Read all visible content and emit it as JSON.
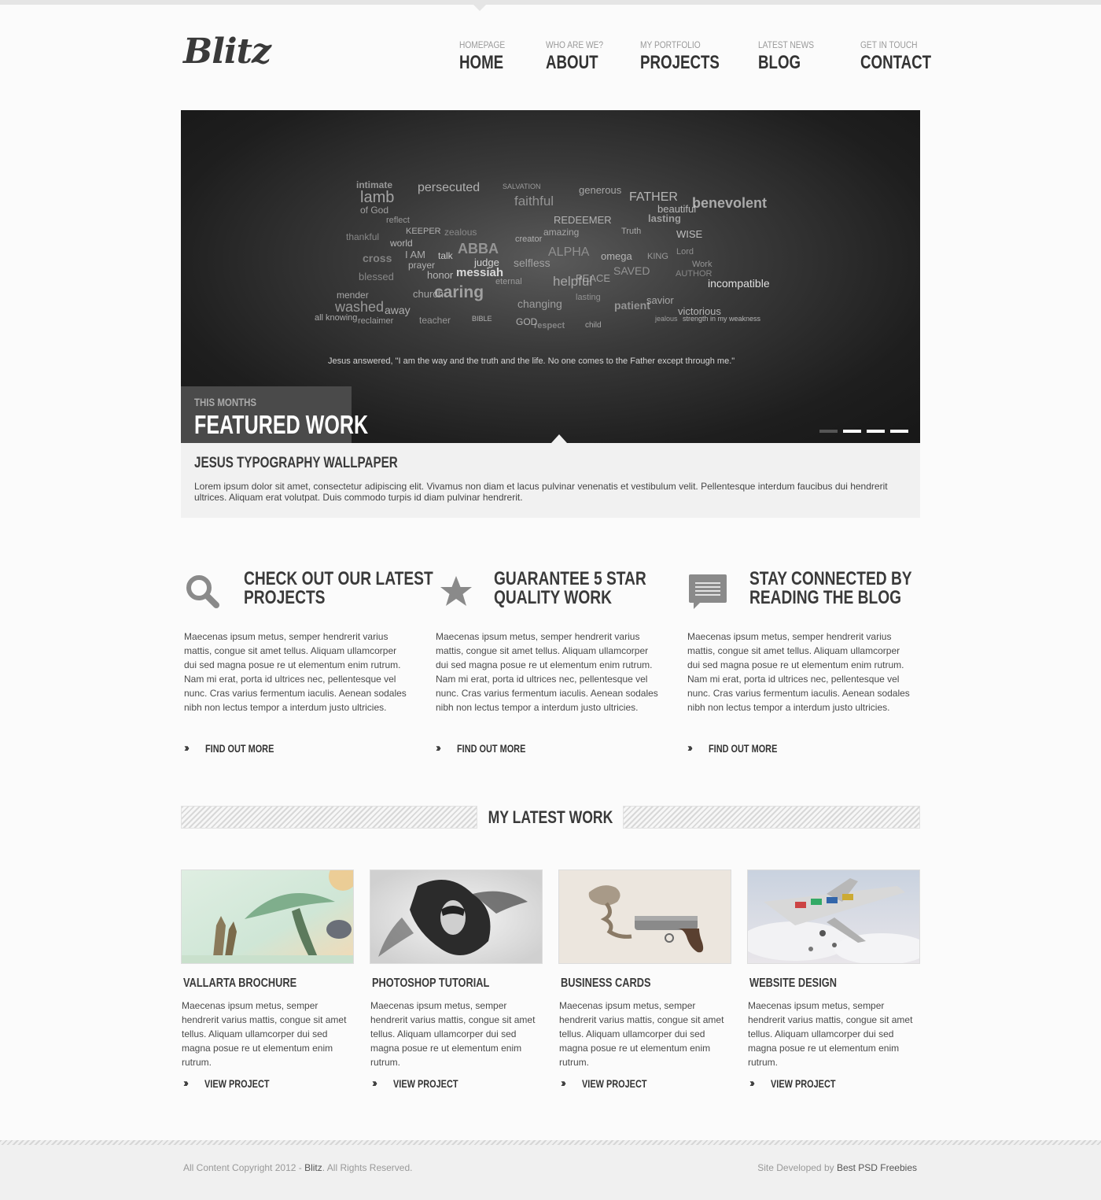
{
  "brand": {
    "logo": "Blitz"
  },
  "nav": [
    {
      "sub": "Homepage",
      "label": "Home"
    },
    {
      "sub": "Who are we?",
      "label": "About"
    },
    {
      "sub": "My Portfolio",
      "label": "Projects"
    },
    {
      "sub": "Latest News",
      "label": "Blog"
    },
    {
      "sub": "Get in touch",
      "label": "Contact"
    }
  ],
  "slider": {
    "quote": "Jesus answered, \"I am the way and the truth and the life. No one comes to the Father except through me.\"",
    "featured_small": "This months",
    "featured_big": "Featured Work",
    "dots_total": 4,
    "active_dot": 1,
    "cloud_words": [
      "intimate",
      "persecuted",
      "lamb",
      "SALVATION",
      "faithful",
      "generous",
      "FATHER",
      "benevolent",
      "of God",
      "reflect",
      "KEEPER",
      "zealous",
      "REDEEMER",
      "Truth",
      "lasting",
      "beautiful",
      "thankful",
      "world",
      "creator",
      "amazing",
      "WISE",
      "ABBA",
      "ALPHA",
      "omega",
      "I AM",
      "talk",
      "KING",
      "Lord",
      "cross",
      "prayer",
      "judge",
      "selfless",
      "Work",
      "blessed",
      "honor",
      "messiah",
      "helpful",
      "PEACE",
      "SAVED",
      "AUTHOR",
      "incompatible",
      "mender",
      "caring",
      "eternal",
      "lasting",
      "washed",
      "away",
      "church",
      "changing",
      "patient",
      "savior",
      "victorious",
      "all knowing",
      "reclaimer",
      "teacher",
      "BIBLE",
      "respect",
      "GOD",
      "child",
      "jealous",
      "strength in my weakness"
    ]
  },
  "caption": {
    "title": "Jesus Typography Wallpaper",
    "text": "Lorem ipsum dolor sit amet, consectetur adipiscing elit. Vivamus non diam et lacus pulvinar venenatis et vestibulum velit. Pellentesque interdum faucibus dui hendrerit ultrices. Aliquam erat volutpat. Duis commodo turpis id diam pulvinar hendrerit."
  },
  "features": [
    {
      "icon": "search-icon",
      "title_line1": "Check out our latest",
      "title_line2": "projects",
      "text": "Maecenas ipsum metus, semper hendrerit varius mattis, congue sit amet tellus. Aliquam ullamcorper dui sed magna posue re ut elementum enim rutrum. Nam mi erat, porta id ultrices nec, pellentesque vel nunc. Cras varius fermentum iaculis. Aenean sodales nibh non lectus tempor a interdum justo ultricies.",
      "link": "Find out more"
    },
    {
      "icon": "star-icon",
      "title_line1": "Guarantee 5 star",
      "title_line2": "quality work",
      "text": "Maecenas ipsum metus, semper hendrerit varius mattis, congue sit amet tellus. Aliquam ullamcorper dui sed magna posue re ut elementum enim rutrum. Nam mi erat, porta id ultrices nec, pellentesque vel nunc. Cras varius fermentum iaculis. Aenean sodales nibh non lectus tempor a interdum justo ultricies.",
      "link": "Find out more"
    },
    {
      "icon": "speech-bubble-icon",
      "title_line1": "Stay connected by",
      "title_line2": "reading the blog",
      "text": "Maecenas ipsum metus, semper hendrerit varius mattis, congue sit amet tellus. Aliquam ullamcorper dui sed magna posue re ut elementum enim rutrum. Nam mi erat, porta id ultrices nec, pellentesque vel nunc. Cras varius fermentum iaculis. Aenean sodales nibh non lectus tempor a interdum justo ultricies.",
      "link": "Find out more"
    }
  ],
  "latest_work": {
    "heading": "My Latest Work",
    "items": [
      {
        "title": "Vallarta Brochure",
        "text": "Maecenas ipsum metus, semper hendrerit varius mattis, congue sit amet tellus. Aliquam ullamcorper dui sed magna posue re ut elementum enim rutrum.",
        "link": "View Project"
      },
      {
        "title": "Photoshop Tutorial",
        "text": "Maecenas ipsum metus, semper hendrerit varius mattis, congue sit amet tellus. Aliquam ullamcorper dui sed magna posue re ut elementum enim rutrum.",
        "link": "View Project"
      },
      {
        "title": "Business Cards",
        "text": "Maecenas ipsum metus, semper hendrerit varius mattis, congue sit amet tellus. Aliquam ullamcorper dui sed magna posue re ut elementum enim rutrum.",
        "link": "View Project"
      },
      {
        "title": "Website Design",
        "text": "Maecenas ipsum metus, semper hendrerit varius mattis, congue sit amet tellus. Aliquam ullamcorper dui sed magna posue re ut elementum enim rutrum.",
        "link": "View Project"
      }
    ]
  },
  "footer": {
    "copyright_prefix": "All Content Copyright 2012 - ",
    "copyright_brand": "Blitz",
    "copyright_suffix": ". All Rights Reserved.",
    "dev_prefix": "Site Developed by ",
    "dev_link": "Best PSD Freebies"
  },
  "colors": {
    "text_dark": "#3a3a3a",
    "slider_bg": "#1e1e1e",
    "caption_bg": "#f1f1f1",
    "footer_bg": "#f0f0f0"
  }
}
